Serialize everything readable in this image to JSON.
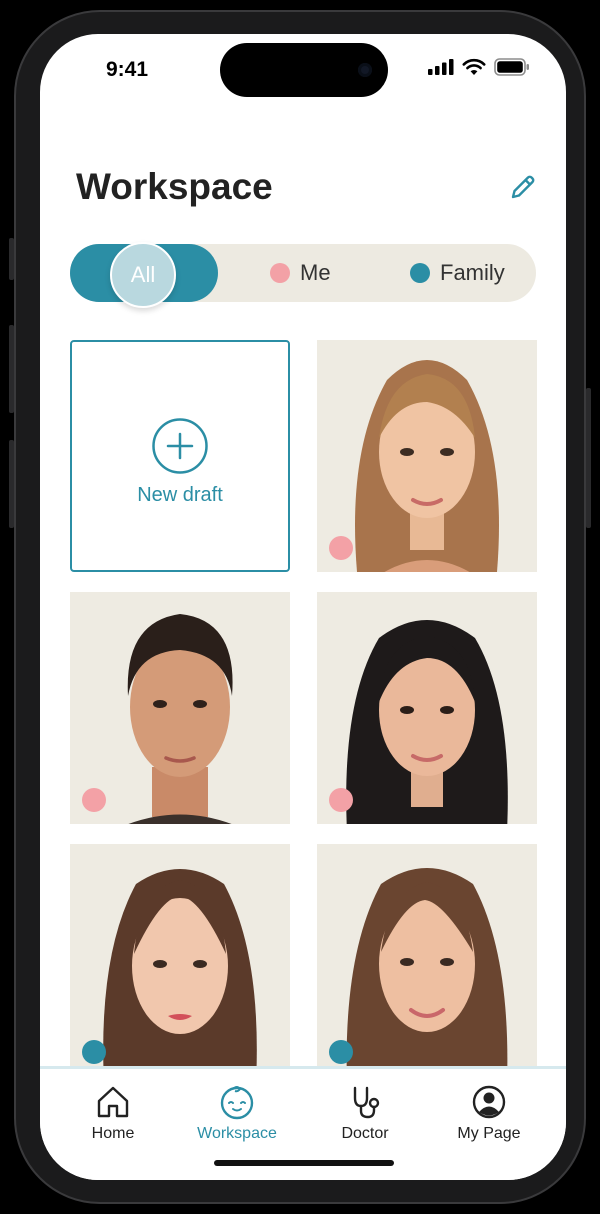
{
  "status": {
    "time": "9:41"
  },
  "header": {
    "title": "Workspace",
    "edit_icon": "pencil-icon"
  },
  "filters": {
    "all": "All",
    "me": "Me",
    "family": "Family"
  },
  "grid": {
    "new_draft_label": "New draft",
    "items": [
      {
        "kind": "portrait",
        "tag": "me",
        "tag_color": "#f3a1a6"
      },
      {
        "kind": "portrait",
        "tag": "me",
        "tag_color": "#f3a1a6"
      },
      {
        "kind": "portrait",
        "tag": "me",
        "tag_color": "#f3a1a6"
      },
      {
        "kind": "portrait",
        "tag": "family",
        "tag_color": "#2b8ea5"
      },
      {
        "kind": "portrait",
        "tag": "family",
        "tag_color": "#2b8ea5"
      }
    ]
  },
  "tabs": [
    {
      "label": "Home",
      "icon": "home-icon",
      "active": false
    },
    {
      "label": "Workspace",
      "icon": "baby-face-icon",
      "active": true
    },
    {
      "label": "Doctor",
      "icon": "stethoscope-icon",
      "active": false
    },
    {
      "label": "My Page",
      "icon": "user-circle-icon",
      "active": false
    }
  ],
  "colors": {
    "accent": "#2b8ea5",
    "me": "#f3a1a6",
    "card_bg": "#eeebe2",
    "filter_bg": "#edeae1"
  }
}
